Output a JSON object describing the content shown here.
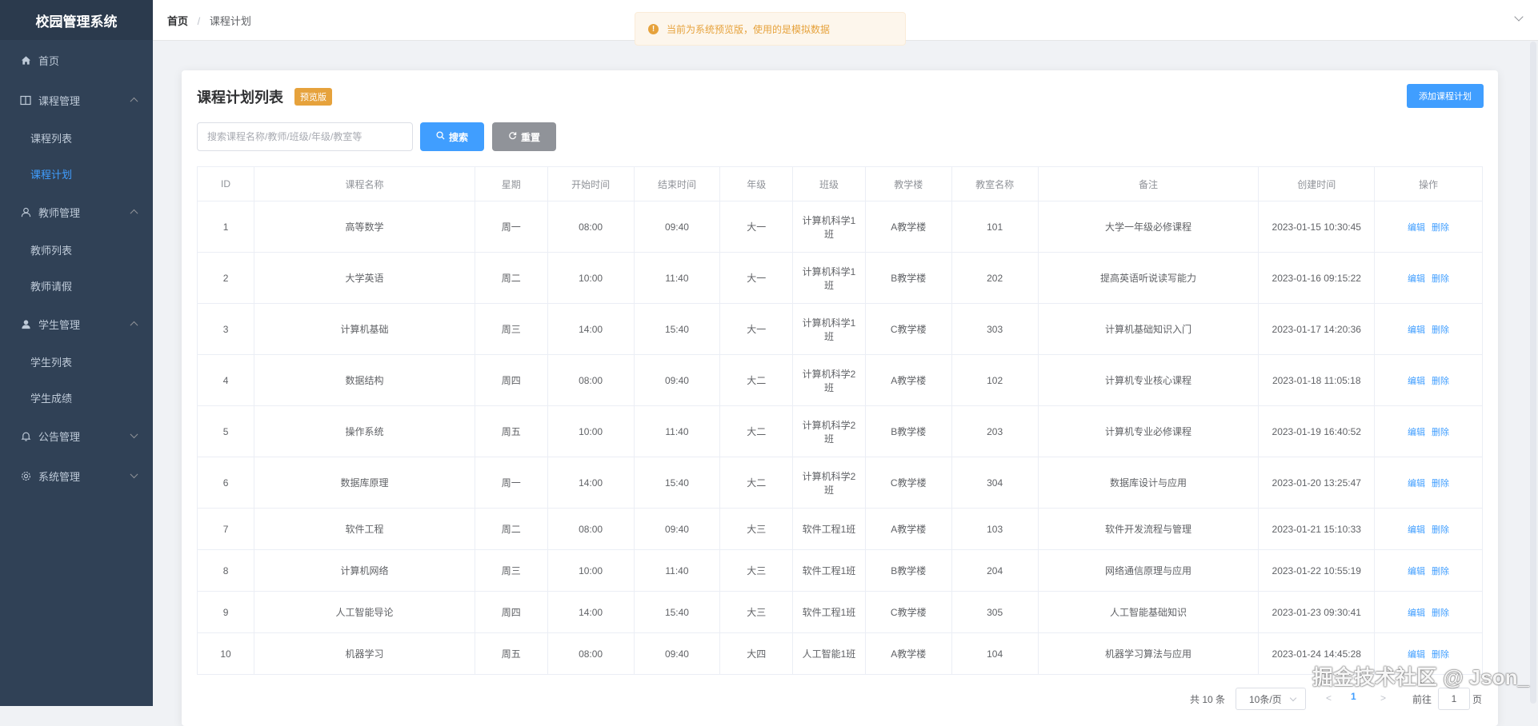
{
  "sidebar": {
    "brand": "校园管理系统",
    "items": [
      {
        "label": "首页"
      },
      {
        "label": "课程管理",
        "children": [
          {
            "label": "课程列表"
          },
          {
            "label": "课程计划"
          }
        ]
      },
      {
        "label": "教师管理",
        "children": [
          {
            "label": "教师列表"
          },
          {
            "label": "教师请假"
          }
        ]
      },
      {
        "label": "学生管理",
        "children": [
          {
            "label": "学生列表"
          },
          {
            "label": "学生成绩"
          }
        ]
      },
      {
        "label": "公告管理"
      },
      {
        "label": "系统管理"
      }
    ]
  },
  "header": {
    "breadcrumb_home": "首页",
    "breadcrumb_sep": "/",
    "breadcrumb_current": "课程计划"
  },
  "notice": {
    "text": "当前为系统预览版，使用的是模拟数据"
  },
  "card": {
    "title": "课程计划列表",
    "tag": "预览版",
    "add_button": "添加课程计划"
  },
  "search": {
    "placeholder": "搜索课程名称/教师/班级/年级/教室等",
    "search_button": "搜索",
    "reset_button": "重置"
  },
  "table": {
    "headers": [
      "ID",
      "课程名称",
      "星期",
      "开始时间",
      "结束时间",
      "年级",
      "班级",
      "教学楼",
      "教室名称",
      "备注",
      "创建时间",
      "操作"
    ],
    "edit_label": "编辑",
    "delete_label": "删除",
    "rows": [
      {
        "id": "1",
        "name": "高等数学",
        "weekday": "周一",
        "start": "08:00",
        "end": "09:40",
        "grade": "大一",
        "class": "计算机科学1班",
        "building": "A教学楼",
        "room": "101",
        "note": "大学一年级必修课程",
        "created": "2023-01-15 10:30:45"
      },
      {
        "id": "2",
        "name": "大学英语",
        "weekday": "周二",
        "start": "10:00",
        "end": "11:40",
        "grade": "大一",
        "class": "计算机科学1班",
        "building": "B教学楼",
        "room": "202",
        "note": "提高英语听说读写能力",
        "created": "2023-01-16 09:15:22"
      },
      {
        "id": "3",
        "name": "计算机基础",
        "weekday": "周三",
        "start": "14:00",
        "end": "15:40",
        "grade": "大一",
        "class": "计算机科学1班",
        "building": "C教学楼",
        "room": "303",
        "note": "计算机基础知识入门",
        "created": "2023-01-17 14:20:36"
      },
      {
        "id": "4",
        "name": "数据结构",
        "weekday": "周四",
        "start": "08:00",
        "end": "09:40",
        "grade": "大二",
        "class": "计算机科学2班",
        "building": "A教学楼",
        "room": "102",
        "note": "计算机专业核心课程",
        "created": "2023-01-18 11:05:18"
      },
      {
        "id": "5",
        "name": "操作系统",
        "weekday": "周五",
        "start": "10:00",
        "end": "11:40",
        "grade": "大二",
        "class": "计算机科学2班",
        "building": "B教学楼",
        "room": "203",
        "note": "计算机专业必修课程",
        "created": "2023-01-19 16:40:52"
      },
      {
        "id": "6",
        "name": "数据库原理",
        "weekday": "周一",
        "start": "14:00",
        "end": "15:40",
        "grade": "大二",
        "class": "计算机科学2班",
        "building": "C教学楼",
        "room": "304",
        "note": "数据库设计与应用",
        "created": "2023-01-20 13:25:47"
      },
      {
        "id": "7",
        "name": "软件工程",
        "weekday": "周二",
        "start": "08:00",
        "end": "09:40",
        "grade": "大三",
        "class": "软件工程1班",
        "building": "A教学楼",
        "room": "103",
        "note": "软件开发流程与管理",
        "created": "2023-01-21 15:10:33"
      },
      {
        "id": "8",
        "name": "计算机网络",
        "weekday": "周三",
        "start": "10:00",
        "end": "11:40",
        "grade": "大三",
        "class": "软件工程1班",
        "building": "B教学楼",
        "room": "204",
        "note": "网络通信原理与应用",
        "created": "2023-01-22 10:55:19"
      },
      {
        "id": "9",
        "name": "人工智能导论",
        "weekday": "周四",
        "start": "14:00",
        "end": "15:40",
        "grade": "大三",
        "class": "软件工程1班",
        "building": "C教学楼",
        "room": "305",
        "note": "人工智能基础知识",
        "created": "2023-01-23 09:30:41"
      },
      {
        "id": "10",
        "name": "机器学习",
        "weekday": "周五",
        "start": "08:00",
        "end": "09:40",
        "grade": "大四",
        "class": "人工智能1班",
        "building": "A教学楼",
        "room": "104",
        "note": "机器学习算法与应用",
        "created": "2023-01-24 14:45:28"
      }
    ]
  },
  "pagination": {
    "total": "共 10 条",
    "page_size": "10条/页",
    "prev": "<",
    "current": "1",
    "next": ">",
    "goto_label": "前往",
    "goto_value": "1",
    "goto_unit": "页"
  },
  "watermark": "掘金技术社区 @ Json_"
}
